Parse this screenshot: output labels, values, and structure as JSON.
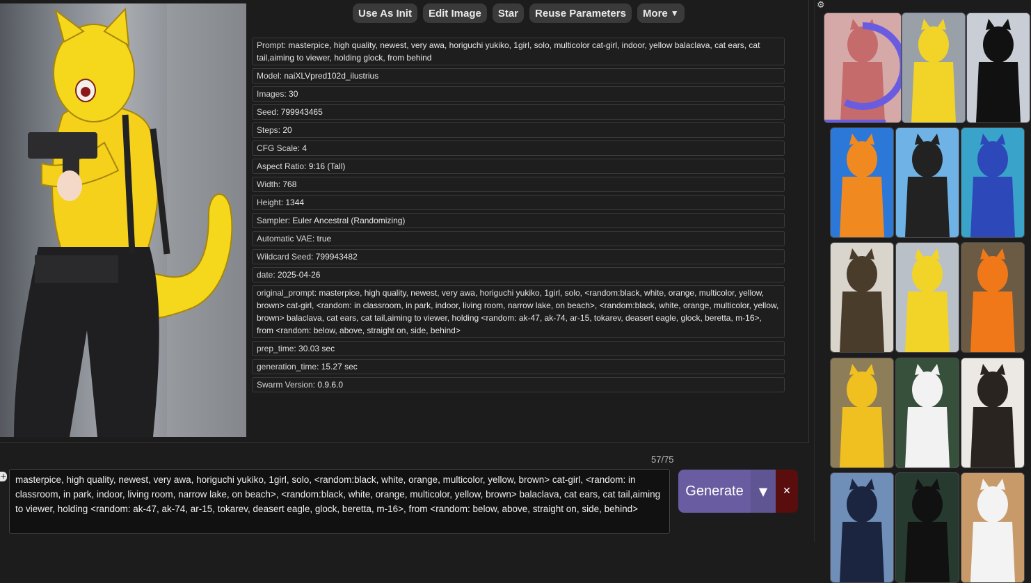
{
  "toolbar": {
    "use_as_init": "Use As Init",
    "edit_image": "Edit Image",
    "star": "Star",
    "reuse_parameters": "Reuse Parameters",
    "more": "More"
  },
  "metadata": [
    {
      "key": "Prompt",
      "value": "masterpice, high quality, newest, very awa, horiguchi yukiko, 1girl, solo, multicolor cat-girl, indoor, yellow balaclava, cat ears, cat tail,aiming to viewer, holding glock, from behind"
    },
    {
      "key": "Model",
      "value": "naiXLVpred102d_ilustrius"
    },
    {
      "key": "Images",
      "value": "30"
    },
    {
      "key": "Seed",
      "value": "799943465"
    },
    {
      "key": "Steps",
      "value": "20"
    },
    {
      "key": "CFG Scale",
      "value": "4"
    },
    {
      "key": "Aspect Ratio",
      "value": "9:16 (Tall)"
    },
    {
      "key": "Width",
      "value": "768"
    },
    {
      "key": "Height",
      "value": "1344"
    },
    {
      "key": "Sampler",
      "value": "Euler Ancestral (Randomizing)"
    },
    {
      "key": "Automatic VAE",
      "value": "true"
    },
    {
      "key": "Wildcard Seed",
      "value": "799943482"
    },
    {
      "key": "date",
      "value": "2025-04-26"
    },
    {
      "key": "original_prompt",
      "value": "masterpice, high quality, newest, very awa, horiguchi yukiko, 1girl, solo, <random:black, white, orange, multicolor, yellow, brown> cat-girl, <random: in classroom, in park, indoor, living room, narrow lake, on beach>, <random:black, white, orange, multicolor, yellow, brown> balaclava, cat ears, cat tail,aiming to viewer, holding <random: ak-47, ak-74, ar-15, tokarev, deasert eagle, glock, beretta, m-16>, from <random: below, above, straight on, side, behind>"
    },
    {
      "key": "prep_time",
      "value": "30.03 sec"
    },
    {
      "key": "generation_time",
      "value": "15.27 sec"
    },
    {
      "key": "Swarm Version",
      "value": "0.9.6.0"
    }
  ],
  "prompt": {
    "token_count": "57/75",
    "text": "masterpice, high quality, newest, very awa, horiguchi yukiko, 1girl, solo, <random:black, white, orange, multicolor, yellow, brown> cat-girl, <random: in classroom, in park, indoor, living room, narrow lake, on beach>, <random:black, white, orange, multicolor, yellow, brown> balaclava, cat ears, cat tail,aiming to viewer, holding <random: ak-47, ak-74, ar-15, tokarev, deasert eagle, glock, beretta, m-16>, from <random: below, above, straight on, side, behind>",
    "generate_label": "Generate"
  },
  "gallery": {
    "thumbnails": [
      {
        "name": "generating",
        "colors": [
          "#c98d8d",
          "#b33a3a"
        ]
      },
      {
        "name": "yellow-cat-girl-glock",
        "colors": [
          "#9aa0a8",
          "#f2d428"
        ]
      },
      {
        "name": "black-cat-girl-classroom",
        "colors": [
          "#c9ced6",
          "#111"
        ]
      },
      {
        "name": "orange-cat-girl-beach",
        "colors": [
          "#2c78d8",
          "#f08a20"
        ]
      },
      {
        "name": "cat-girl-eagle",
        "colors": [
          "#6fb2e6",
          "#222"
        ]
      },
      {
        "name": "blue-cat-girl-cliff",
        "colors": [
          "#3aa3c9",
          "#2d48b8"
        ]
      },
      {
        "name": "brown-cat-girl-soldier",
        "colors": [
          "#d9d4cc",
          "#4a3c2a"
        ]
      },
      {
        "name": "yellow-cat-girl-pistol",
        "colors": [
          "#b9c0c8",
          "#f2d428"
        ]
      },
      {
        "name": "orange-cat-girl-classroom",
        "colors": [
          "#6b5a44",
          "#f07818"
        ]
      },
      {
        "name": "yellow-hoodie-blue-hair",
        "colors": [
          "#8d7d58",
          "#f0c020"
        ]
      },
      {
        "name": "white-cat-girl-cat",
        "colors": [
          "#36503c",
          "#f2f2f2"
        ]
      },
      {
        "name": "black-cat-girl-rifle",
        "colors": [
          "#ece9e4",
          "#2a2420"
        ]
      },
      {
        "name": "navy-cat-soldier",
        "colors": [
          "#6f8fb8",
          "#1b2540"
        ]
      },
      {
        "name": "green-cat-soldier",
        "colors": [
          "#263a30",
          "#111"
        ]
      },
      {
        "name": "laughing-girl",
        "colors": [
          "#c89a6a",
          "#f3f3f3"
        ]
      }
    ],
    "accent": "#6a5ce0"
  }
}
